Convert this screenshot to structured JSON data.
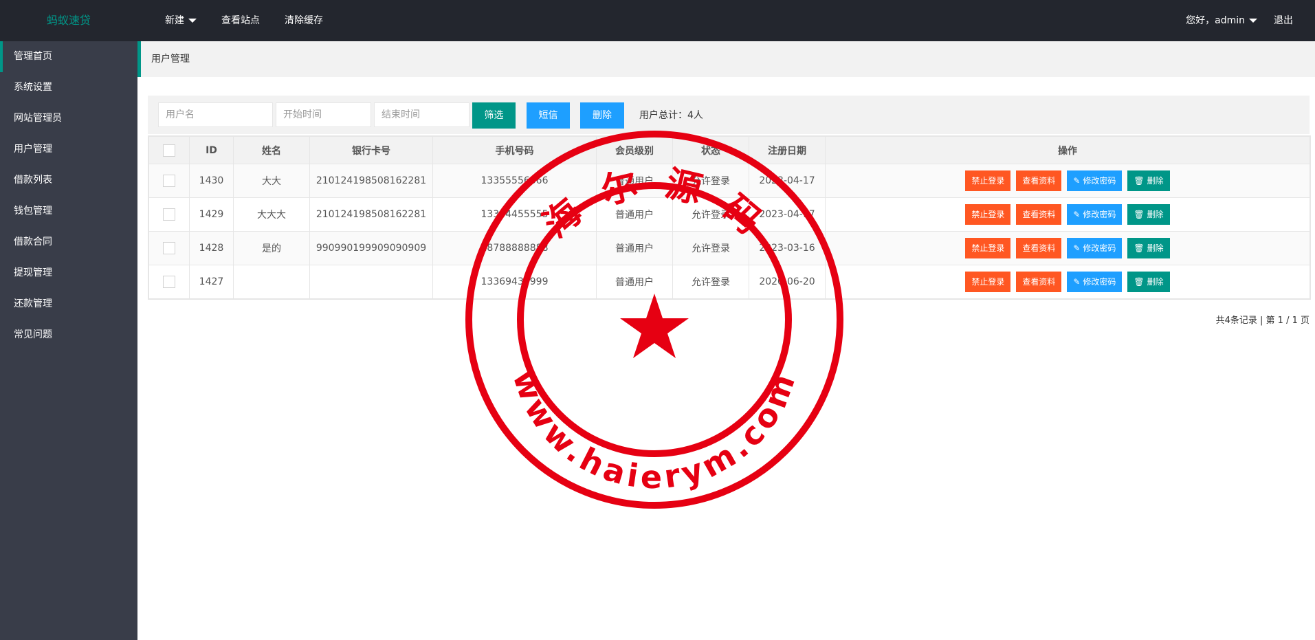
{
  "header": {
    "logo": "蚂蚁速贷",
    "nav": [
      "新建",
      "查看站点",
      "清除缓存"
    ],
    "greeting": "您好，admin",
    "logout": "退出"
  },
  "sidebar": {
    "items": [
      "管理首页",
      "系统设置",
      "网站管理员",
      "用户管理",
      "借款列表",
      "钱包管理",
      "借款合同",
      "提现管理",
      "还款管理",
      "常见问题"
    ]
  },
  "breadcrumb": "用户管理",
  "filter": {
    "username_placeholder": "用户名",
    "start_placeholder": "开始时间",
    "end_placeholder": "结束时间",
    "filter_btn": "筛选",
    "sms_btn": "短信",
    "delete_btn": "删除",
    "total": "用户总计：4人"
  },
  "table": {
    "headers": [
      "ID",
      "姓名",
      "银行卡号",
      "手机号码",
      "会员级别",
      "状态",
      "注册日期",
      "操作"
    ],
    "rows": [
      {
        "id": "1430",
        "name": "大大",
        "card": "210124198508162281",
        "phone": "13355556666",
        "level": "普通用户",
        "status": "允许登录",
        "date": "2023-04-17"
      },
      {
        "id": "1429",
        "name": "大大大",
        "card": "210124198508162281",
        "phone": "13344455555",
        "level": "普通用户",
        "status": "允许登录",
        "date": "2023-04-17"
      },
      {
        "id": "1428",
        "name": "是的",
        "card": "990990199909090909",
        "phone": "18788888888",
        "level": "普通用户",
        "status": "允许登录",
        "date": "2023-03-16"
      },
      {
        "id": "1427",
        "name": "",
        "card": "",
        "phone": "13369433999",
        "level": "普通用户",
        "status": "允许登录",
        "date": "2020-06-20"
      }
    ],
    "actions": {
      "ban": "禁止登录",
      "view": "查看资料",
      "pwd": "修改密码",
      "del": "删除"
    }
  },
  "pager": "共4条记录 | 第 1 / 1 页",
  "stamp": {
    "top_text": "海 尔 源 码",
    "bottom_text": "www.haierym.com",
    "color": "#e60012"
  },
  "colors": {
    "accent": "#009688",
    "orange": "#ff5722",
    "blue": "#1e9fff",
    "header_bg": "#23262e",
    "sidebar_bg": "#393d49"
  }
}
